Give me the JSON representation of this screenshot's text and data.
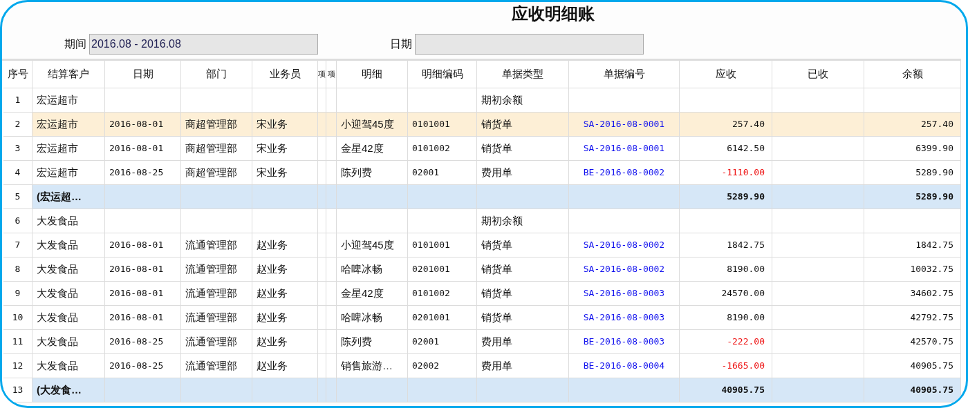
{
  "title": "应收明细账",
  "filters": [
    {
      "label": "期间",
      "value": "2016.08 - 2016.08"
    },
    {
      "label": "日期"
    }
  ],
  "table": {
    "columns": [
      "序号",
      "结算客户",
      "日期",
      "部门",
      "业务员",
      "项",
      "项",
      "明细",
      "明细编码",
      "单据类型",
      "单据编号",
      "应收",
      "已收",
      "余额"
    ],
    "rows": [
      {
        "kind": "opening",
        "selected": false,
        "no": "1",
        "customer": "宏运超市",
        "doc_type": "期初余额"
      },
      {
        "kind": "detail",
        "selected": true,
        "no": "2",
        "customer": "宏运超市",
        "date": "2016-08-01",
        "dept": "商超管理部",
        "salesperson": "宋业务",
        "detail": "小迎驾45度",
        "detail_code": "0101001",
        "doc_type": "销货单",
        "doc_no": "SA-2016-08-0001",
        "receivable": "257.40",
        "negative": false,
        "balance": "257.40"
      },
      {
        "kind": "detail",
        "selected": false,
        "no": "3",
        "customer": "宏运超市",
        "date": "2016-08-01",
        "dept": "商超管理部",
        "salesperson": "宋业务",
        "detail": "金星42度",
        "detail_code": "0101002",
        "doc_type": "销货单",
        "doc_no": "SA-2016-08-0001",
        "receivable": "6142.50",
        "negative": false,
        "balance": "6399.90"
      },
      {
        "kind": "detail",
        "selected": false,
        "no": "4",
        "customer": "宏运超市",
        "date": "2016-08-25",
        "dept": "商超管理部",
        "salesperson": "宋业务",
        "detail": "陈列费",
        "detail_code": "02001",
        "doc_type": "费用单",
        "doc_no": "BE-2016-08-0002",
        "receivable": "-1110.00",
        "negative": true,
        "balance": "5289.90"
      },
      {
        "kind": "subtotal",
        "selected": false,
        "no": "5",
        "customer": "(宏运超…",
        "receivable": "5289.90",
        "balance": "5289.90"
      },
      {
        "kind": "opening",
        "selected": false,
        "no": "6",
        "customer": "大发食品",
        "doc_type": "期初余额"
      },
      {
        "kind": "detail",
        "selected": false,
        "no": "7",
        "customer": "大发食品",
        "date": "2016-08-01",
        "dept": "流通管理部",
        "salesperson": "赵业务",
        "detail": "小迎驾45度",
        "detail_code": "0101001",
        "doc_type": "销货单",
        "doc_no": "SA-2016-08-0002",
        "receivable": "1842.75",
        "negative": false,
        "balance": "1842.75"
      },
      {
        "kind": "detail",
        "selected": false,
        "no": "8",
        "customer": "大发食品",
        "date": "2016-08-01",
        "dept": "流通管理部",
        "salesperson": "赵业务",
        "detail": "哈啤冰畅",
        "detail_code": "0201001",
        "doc_type": "销货单",
        "doc_no": "SA-2016-08-0002",
        "receivable": "8190.00",
        "negative": false,
        "balance": "10032.75"
      },
      {
        "kind": "detail",
        "selected": false,
        "no": "9",
        "customer": "大发食品",
        "date": "2016-08-01",
        "dept": "流通管理部",
        "salesperson": "赵业务",
        "detail": "金星42度",
        "detail_code": "0101002",
        "doc_type": "销货单",
        "doc_no": "SA-2016-08-0003",
        "receivable": "24570.00",
        "negative": false,
        "balance": "34602.75"
      },
      {
        "kind": "detail",
        "selected": false,
        "no": "10",
        "customer": "大发食品",
        "date": "2016-08-01",
        "dept": "流通管理部",
        "salesperson": "赵业务",
        "detail": "哈啤冰畅",
        "detail_code": "0201001",
        "doc_type": "销货单",
        "doc_no": "SA-2016-08-0003",
        "receivable": "8190.00",
        "negative": false,
        "balance": "42792.75"
      },
      {
        "kind": "detail",
        "selected": false,
        "no": "11",
        "customer": "大发食品",
        "date": "2016-08-25",
        "dept": "流通管理部",
        "salesperson": "赵业务",
        "detail": "陈列费",
        "detail_code": "02001",
        "doc_type": "费用单",
        "doc_no": "BE-2016-08-0003",
        "receivable": "-222.00",
        "negative": true,
        "balance": "42570.75"
      },
      {
        "kind": "detail",
        "selected": false,
        "no": "12",
        "customer": "大发食品",
        "date": "2016-08-25",
        "dept": "流通管理部",
        "salesperson": "赵业务",
        "detail": "销售旅游…",
        "detail_code": "02002",
        "doc_type": "费用单",
        "doc_no": "BE-2016-08-0004",
        "receivable": "-1665.00",
        "negative": true,
        "balance": "40905.75"
      },
      {
        "kind": "subtotal",
        "selected": false,
        "no": "13",
        "customer": "(大发食…",
        "receivable": "40905.75",
        "balance": "40905.75"
      }
    ]
  }
}
